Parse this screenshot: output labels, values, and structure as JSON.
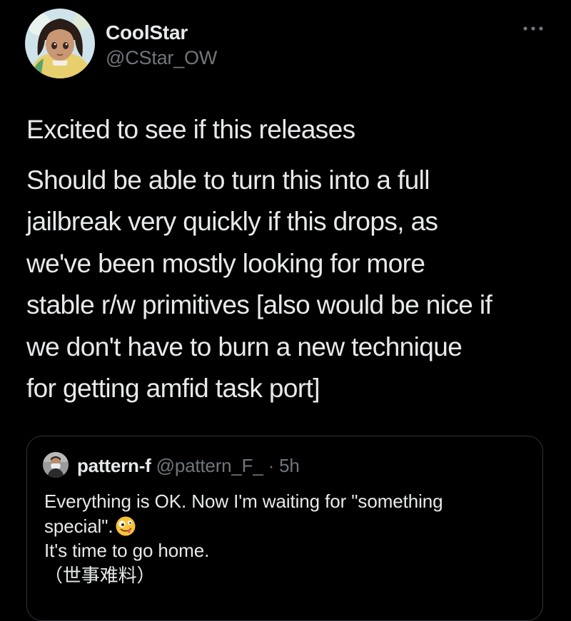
{
  "author": {
    "display_name": "CoolStar",
    "handle": "@CStar_OW",
    "avatar_icon": "anime-avatar-icon"
  },
  "menu": {
    "icon": "more-options-icon",
    "glyph": "•••"
  },
  "tweet": {
    "paragraph_1": [
      "Excited to see if this releases"
    ],
    "paragraph_2": [
      "Should be able to turn this into a full",
      "jailbreak very quickly if this drops, as",
      "we've been mostly looking for more",
      "stable r/w primitives [also would be nice if",
      "we don't have to burn a new technique",
      "for getting amfid task port]"
    ]
  },
  "quoted_tweet": {
    "display_name": "pattern-f",
    "handle": "@pattern_F_",
    "separator": "·",
    "time": "5h",
    "lines": [
      "Everything is OK. Now I'm waiting for \"something",
      "special\".",
      "It's time to go home.",
      "（世事难料）"
    ],
    "emoji": "zany-face-emoji"
  },
  "colors": {
    "background": "#000000",
    "text_primary": "#e7e9ea",
    "text_secondary": "#71767b",
    "border": "#2f3336"
  }
}
